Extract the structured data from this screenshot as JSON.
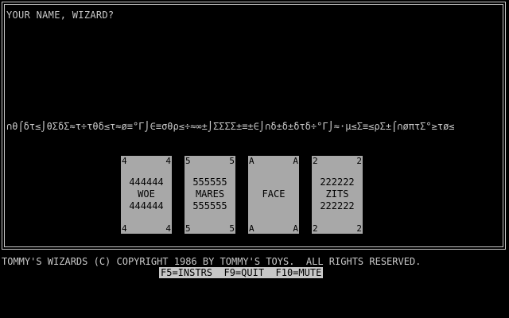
{
  "prompt": "YOUR NAME, WIZARD?",
  "rune_strip": "∩θ⌠δτ≤⌡θΣδΣ≈τ÷τθδ≤τ≈ø≡°Γ⌡∈≡σθρ≤÷≈∞±⌡ΣΣΣΣ±≡±∈⌡∩δ±δ±δτδ÷°Γ⌡≈·µ≤Σ≡≤ρΣ±⌠∩øπτΣ°≥τø≤",
  "cards": [
    {
      "corner": "4",
      "top_line": "444444",
      "name": "WOE",
      "bottom_line": "444444"
    },
    {
      "corner": "5",
      "top_line": "555555",
      "name": "MARES",
      "bottom_line": "555555"
    },
    {
      "corner": "A",
      "top_line": "",
      "name": "FACE",
      "bottom_line": ""
    },
    {
      "corner": "2",
      "top_line": "222222",
      "name": "ZITS",
      "bottom_line": "222222"
    }
  ],
  "copyright": "TOMMY'S WIZARDS (C) COPYRIGHT 1986 BY TOMMY'S TOYS.  ALL RIGHTS RESERVED.",
  "function_keys": "F5=INSTRS  F9=QUIT  F10=MUTE",
  "colors": {
    "background": "#000000",
    "text": "#c8c8c8",
    "card": "#a8a8a8",
    "card_text": "#000000"
  }
}
